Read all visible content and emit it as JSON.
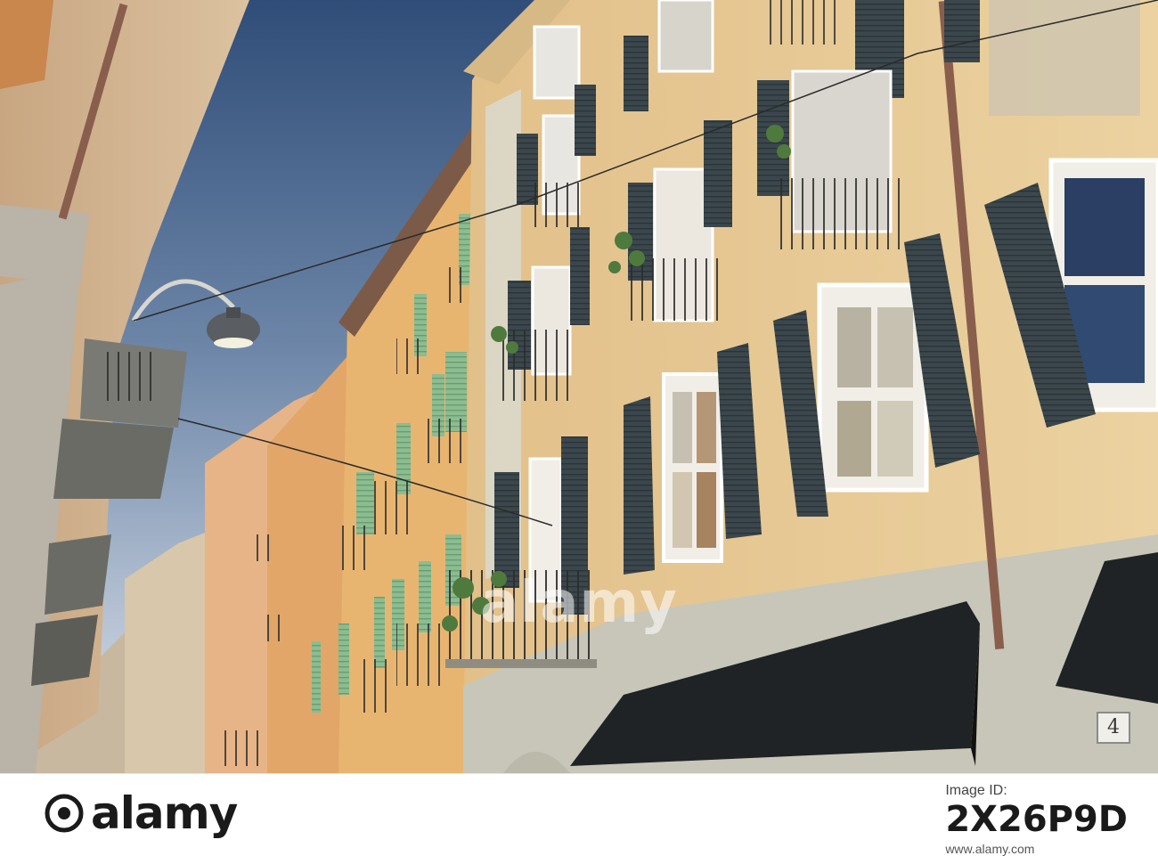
{
  "photo": {
    "description_icons": [
      "street-lamp-icon",
      "shutter-icon",
      "balcony-icon",
      "awning-icon"
    ],
    "house_number": "4",
    "watermark": "alamy",
    "colors": {
      "sky_top": "#3b5a86",
      "sky_bottom": "#c9d5e3",
      "facade_main": "#e6c88f",
      "facade_mid": "#e3b06e",
      "facade_far": "#e9b98a",
      "shutter_dark": "#3d4a4f",
      "shutter_green": "#86b58c",
      "awning": "#1f2326",
      "ground_band": "#c7c6b8"
    }
  },
  "footer": {
    "brand": "alamy",
    "label": "Image ID:",
    "image_id": "2X26P9D",
    "site": "www.alamy.com"
  }
}
